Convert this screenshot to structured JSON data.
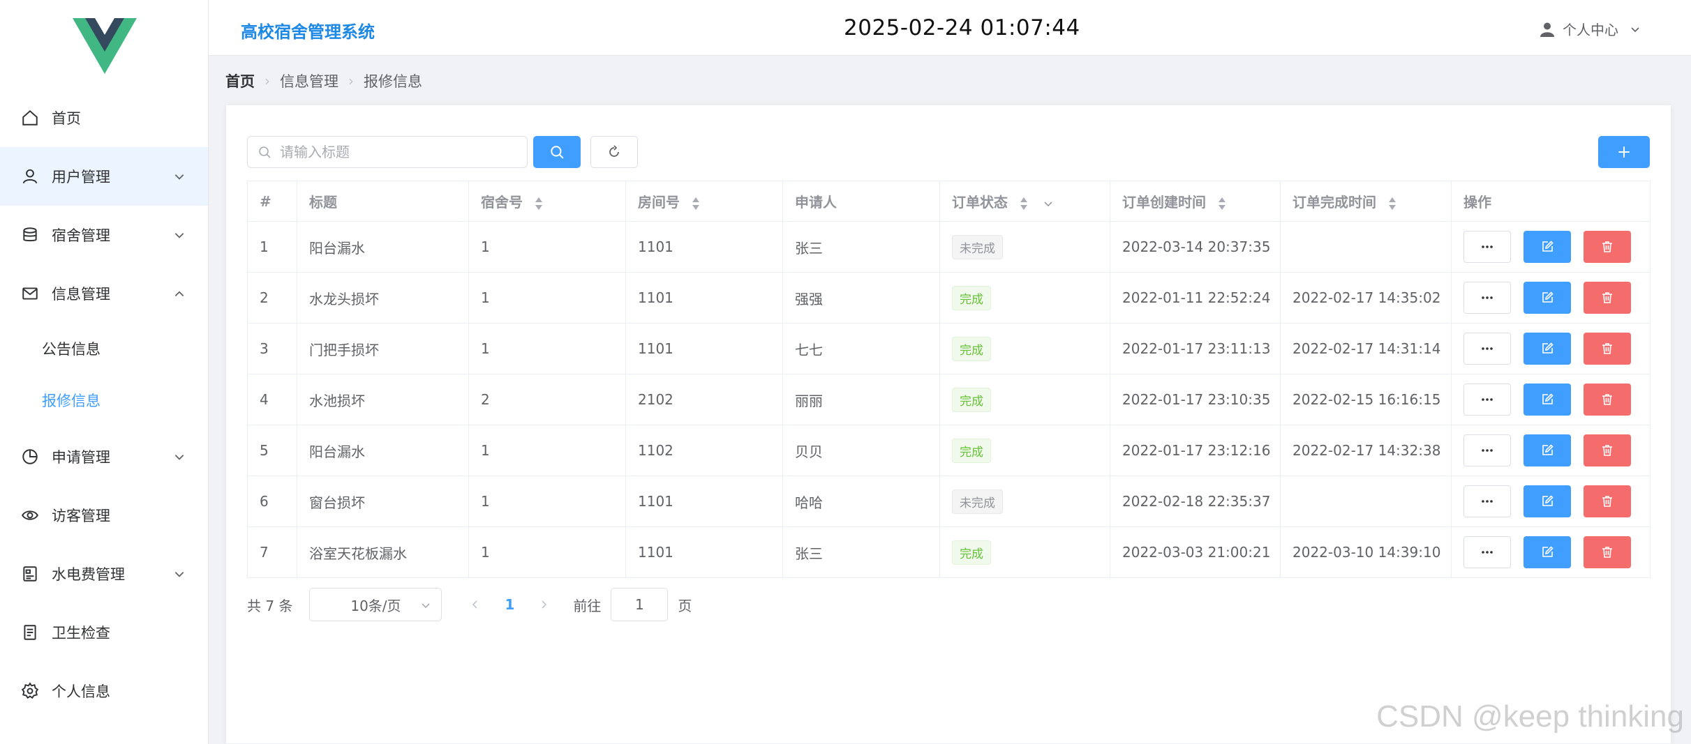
{
  "sidebar": {
    "items": [
      {
        "label": "首页",
        "icon": "home-icon"
      },
      {
        "label": "用户管理",
        "icon": "user-icon"
      },
      {
        "label": "宿舍管理",
        "icon": "database-icon"
      },
      {
        "label": "信息管理",
        "icon": "message-icon"
      },
      {
        "label": "申请管理",
        "icon": "pie-chart-icon"
      },
      {
        "label": "访客管理",
        "icon": "eye-icon"
      },
      {
        "label": "水电费管理",
        "icon": "money-icon"
      },
      {
        "label": "卫生检查",
        "icon": "document-icon"
      },
      {
        "label": "个人信息",
        "icon": "setting-icon"
      }
    ],
    "sub_items": [
      {
        "label": "公告信息"
      },
      {
        "label": "报修信息",
        "active": true
      }
    ]
  },
  "header": {
    "title": "高校宿舍管理系统",
    "clock": "2025-02-24 01:07:44",
    "user_center": "个人中心"
  },
  "breadcrumb": [
    "首页",
    "信息管理",
    "报修信息"
  ],
  "toolbar": {
    "search_placeholder": "请输入标题"
  },
  "table": {
    "columns": [
      "#",
      "标题",
      "宿舍号",
      "房间号",
      "申请人",
      "订单状态",
      "订单创建时间",
      "订单完成时间",
      "操作"
    ],
    "rows": [
      {
        "no": "1",
        "title": "阳台漏水",
        "dorm": "1",
        "room": "1101",
        "applicant": "张三",
        "status": "未完成",
        "created": "2022-03-14 20:37:35",
        "finished": ""
      },
      {
        "no": "2",
        "title": "水龙头损坏",
        "dorm": "1",
        "room": "1101",
        "applicant": "强强",
        "status": "完成",
        "created": "2022-01-11 22:52:24",
        "finished": "2022-02-17 14:35:02"
      },
      {
        "no": "3",
        "title": "门把手损坏",
        "dorm": "1",
        "room": "1101",
        "applicant": "七七",
        "status": "完成",
        "created": "2022-01-17 23:11:13",
        "finished": "2022-02-17 14:31:14"
      },
      {
        "no": "4",
        "title": "水池损坏",
        "dorm": "2",
        "room": "2102",
        "applicant": "丽丽",
        "status": "完成",
        "created": "2022-01-17 23:10:35",
        "finished": "2022-02-15 16:16:15"
      },
      {
        "no": "5",
        "title": "阳台漏水",
        "dorm": "1",
        "room": "1102",
        "applicant": "贝贝",
        "status": "完成",
        "created": "2022-01-17 23:12:16",
        "finished": "2022-02-17 14:32:38"
      },
      {
        "no": "6",
        "title": "窗台损坏",
        "dorm": "1",
        "room": "1101",
        "applicant": "哈哈",
        "status": "未完成",
        "created": "2022-02-18 22:35:37",
        "finished": ""
      },
      {
        "no": "7",
        "title": "浴室天花板漏水",
        "dorm": "1",
        "room": "1101",
        "applicant": "张三",
        "status": "完成",
        "created": "2022-03-03 21:00:21",
        "finished": "2022-03-10 14:39:10"
      }
    ]
  },
  "pagination": {
    "total_text": "共 7 条",
    "page_size": "10条/页",
    "current_page": "1",
    "goto_label": "前往",
    "goto_value": "1",
    "page_suffix": "页"
  },
  "watermark": "CSDN @keep   thinking",
  "colors": {
    "primary": "#409eff",
    "danger": "#f56c6c",
    "success": "#67c23a",
    "title_blue": "#1e88e5"
  }
}
